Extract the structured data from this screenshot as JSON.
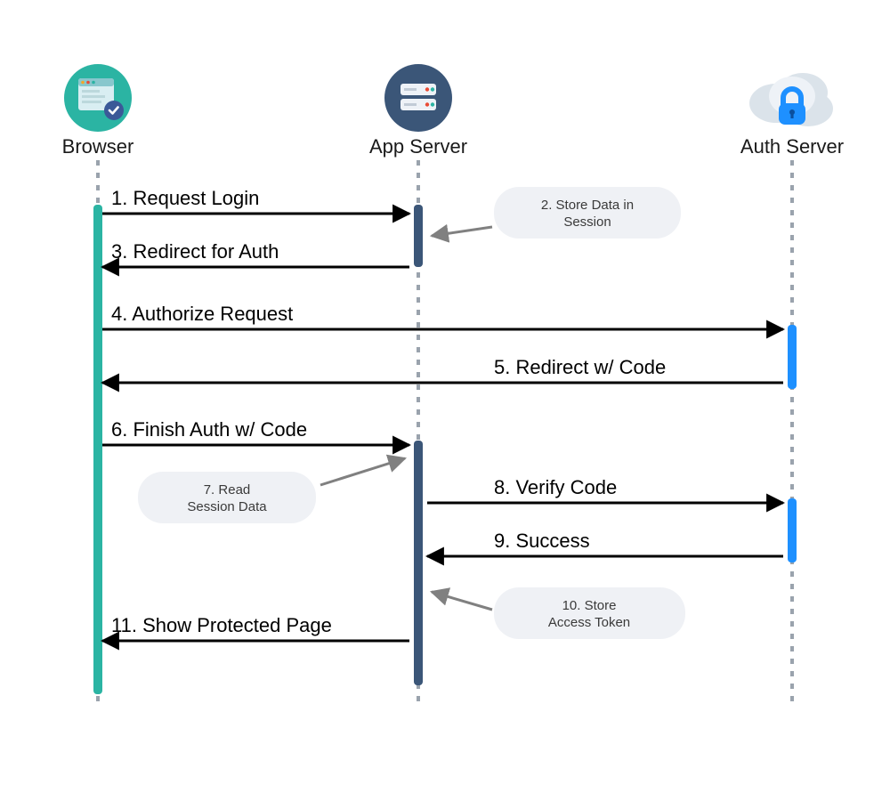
{
  "actors": {
    "browser": "Browser",
    "app": "App Server",
    "auth": "Auth Server"
  },
  "messages": {
    "m1": "1. Request Login",
    "m3": "3. Redirect for Auth",
    "m4": "4. Authorize Request",
    "m5": "5. Redirect w/ Code",
    "m6": "6. Finish Auth w/ Code",
    "m8": "8. Verify Code",
    "m9": "9. Success",
    "m11": "11. Show Protected Page"
  },
  "notes": {
    "n2a": "2. Store Data in",
    "n2b": "Session",
    "n7a": "7. Read",
    "n7b": "Session Data",
    "n10a": "10. Store",
    "n10b": "Access Token"
  },
  "colors": {
    "browser_circle": "#2bb4a3",
    "browser_check": "#3b5998",
    "app_circle": "#3b5678",
    "auth_cloud": "#dbe3ea",
    "auth_lock": "#1e90ff",
    "lifeline": "#9aa3ad",
    "browser_bar": "#2bb4a3",
    "app_bar": "#3b5678",
    "auth_bar": "#1e90ff",
    "arrow_gray": "#808080"
  }
}
